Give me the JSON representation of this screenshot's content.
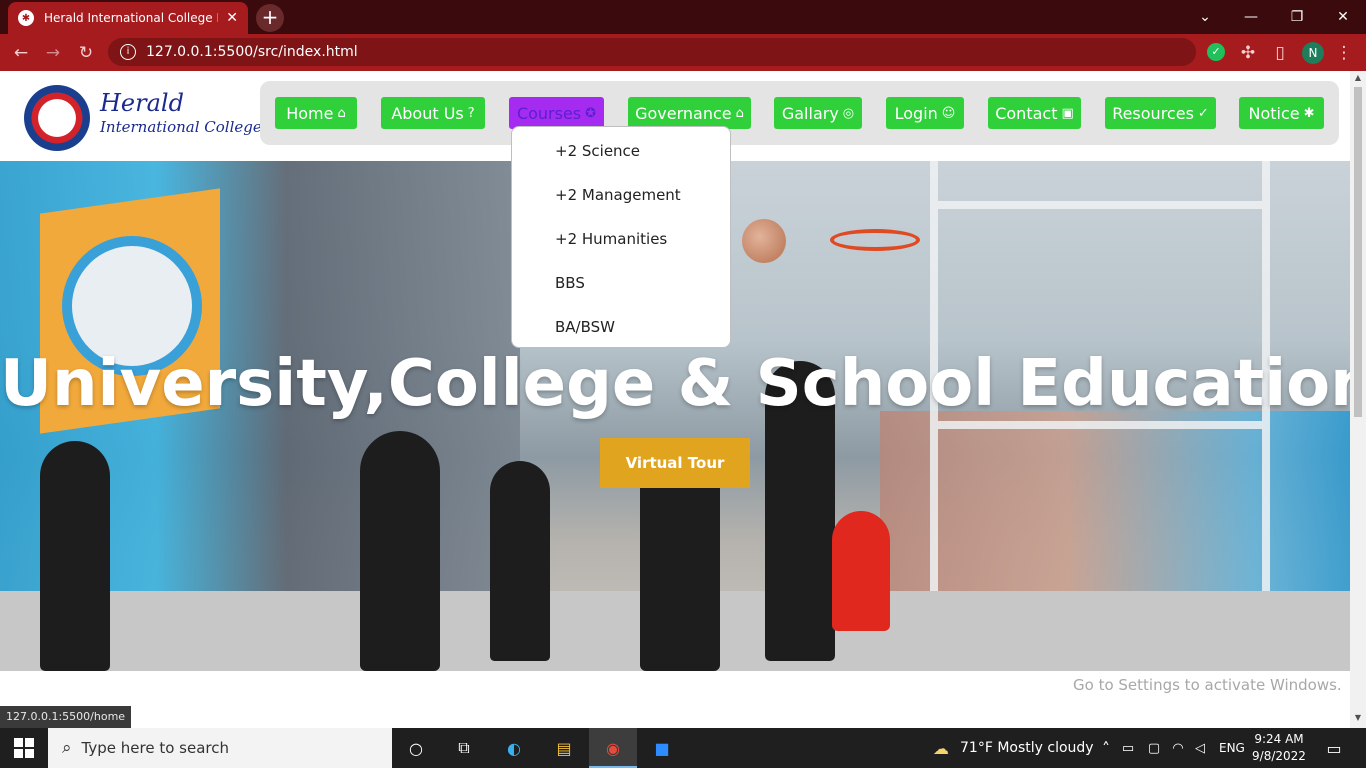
{
  "browser": {
    "tab_title": "Herald International College Basi",
    "url": "127.0.0.1:5500/src/index.html",
    "status_url": "127.0.0.1:5500/home",
    "profile_initial": "N"
  },
  "site": {
    "brand_line1": "Herald",
    "brand_line2": "International College",
    "nav": [
      {
        "label": "Home",
        "icon": "home-icon",
        "glyph": "⌂"
      },
      {
        "label": "About Us",
        "icon": "question-icon",
        "glyph": "?"
      },
      {
        "label": "Courses",
        "icon": "award-icon",
        "glyph": "✪",
        "active": true
      },
      {
        "label": "Governance",
        "icon": "bank-icon",
        "glyph": "⌂"
      },
      {
        "label": "Gallary",
        "icon": "gallery-icon",
        "glyph": "◎"
      },
      {
        "label": "Login",
        "icon": "user-circle-icon",
        "glyph": "☺"
      },
      {
        "label": "Contact",
        "icon": "contact-card-icon",
        "glyph": "▣"
      },
      {
        "label": "Resources",
        "icon": "check-circle-icon",
        "glyph": "✓"
      },
      {
        "label": "Notice",
        "icon": "megaphone-icon",
        "glyph": "✱"
      }
    ],
    "courses_dropdown": [
      "+2 Science",
      "+2 Management",
      "+2 Humanities",
      "BBS",
      "BA/BSW"
    ],
    "hero_title": "University,College & School Education",
    "cta_label": "Virtual Tour",
    "nav_color": "#2fd03a",
    "active_color": "#a52bf0",
    "cta_color": "#e0a41f"
  },
  "os": {
    "watermark": "Go to Settings to activate Windows.",
    "search_placeholder": "Type here to search",
    "weather": "71°F  Mostly cloudy",
    "language": "ENG",
    "time": "9:24 AM",
    "date": "9/8/2022"
  }
}
